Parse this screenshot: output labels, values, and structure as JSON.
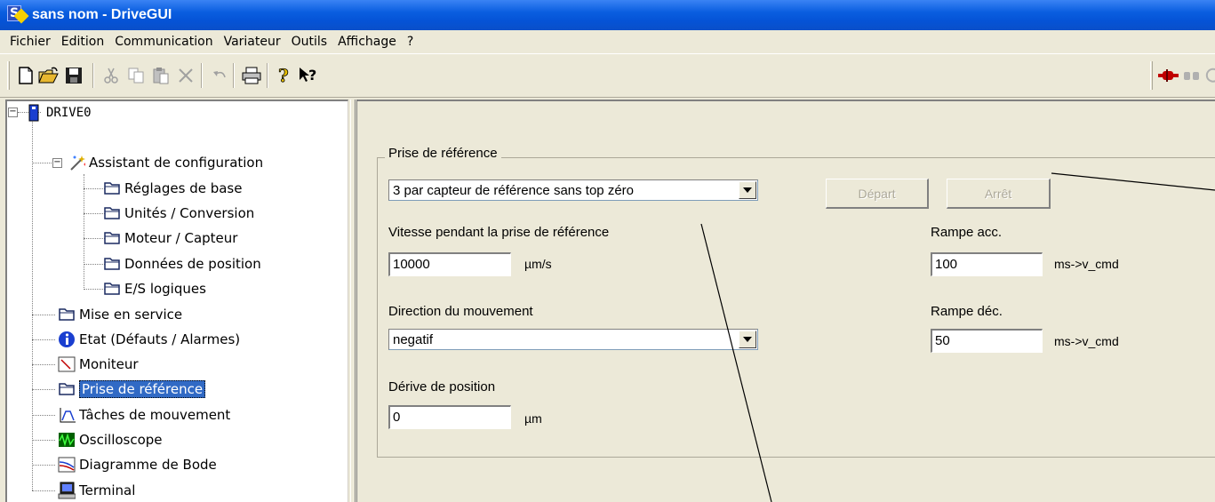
{
  "window": {
    "title": "sans nom - DriveGUI"
  },
  "menu": [
    "Fichier",
    "Edition",
    "Communication",
    "Variateur",
    "Outils",
    "Affichage",
    "?"
  ],
  "toolbar": {
    "left_icons": [
      "new-file-icon",
      "open-folder-icon",
      "save-disk-icon",
      "cut-icon",
      "copy-icon",
      "paste-icon",
      "delete-icon",
      "undo-icon",
      "print-icon",
      "help-icon",
      "context-help-icon"
    ],
    "right_icons": [
      "connect-plug-icon",
      "disconnect-icon",
      "refresh-icon"
    ]
  },
  "tree": {
    "root": "DRIVE0",
    "wizard": "Assistant de configuration",
    "wizard_children": [
      "Réglages de base",
      "Unités / Conversion",
      "Moteur / Capteur",
      "Données de position",
      "E/S logiques"
    ],
    "items": [
      "Mise en service",
      "Etat (Défauts / Alarmes)",
      "Moniteur",
      "Prise de référence",
      "Tâches de mouvement",
      "Oscilloscope",
      "Diagramme de Bode",
      "Terminal"
    ],
    "selected": "Prise de référence"
  },
  "homing": {
    "group_title": "Prise de référence",
    "mode_value": "3 par capteur de référence sans top zéro",
    "start_label": "Départ",
    "stop_label": "Arrêt",
    "speed_label": "Vitesse pendant la prise de référence",
    "speed_value": "10000",
    "speed_unit": "µm/s",
    "accel_label": "Rampe acc.",
    "accel_value": "100",
    "accel_unit": "ms->v_cmd",
    "direction_label": "Direction du mouvement",
    "direction_value": "negatif",
    "decel_label": "Rampe déc.",
    "decel_value": "50",
    "decel_unit": "ms->v_cmd",
    "offset_label": "Dérive de position",
    "offset_value": "0",
    "offset_unit": "µm"
  }
}
